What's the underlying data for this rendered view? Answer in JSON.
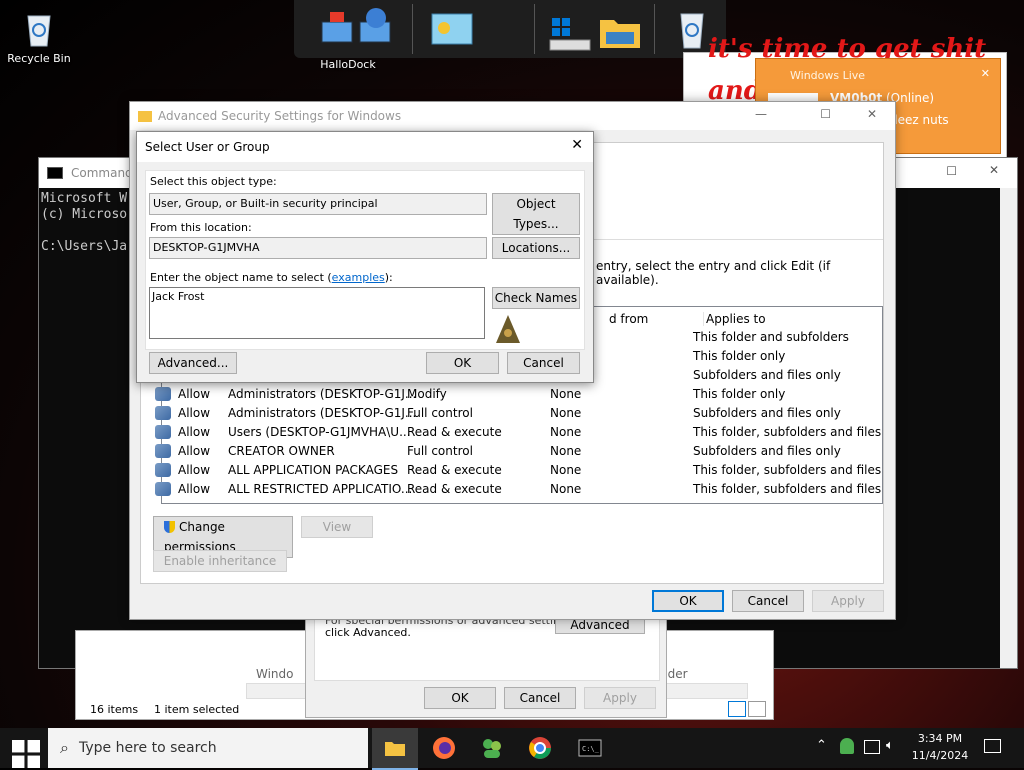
{
  "desktop": {
    "recycle_bin": "Recycle Bin",
    "dock_label": "HalloDock",
    "graffiti_line1": "it's time to get shit",
    "graffiti_line2": "and",
    "popup_title": "Windows Live",
    "popup_user": "VM0b0t",
    "popup_status": "(Online)",
    "popup_msg": "deez nuts"
  },
  "console": {
    "title": "Command",
    "lines": [
      "Microsoft W",
      "(c) Microso",
      "",
      "C:\\Users\\Ja"
    ]
  },
  "adv_dialog": {
    "title": "Advanced Security Settings for Windows",
    "instructions": "entry, select the entry and click Edit (if available).",
    "col_inherited": "d from",
    "col_applies": "Applies to",
    "rows": [
      {
        "type": "",
        "principal": "",
        "access": "",
        "inherited": "",
        "applies": "This folder and subfolders"
      },
      {
        "type": "",
        "principal": "",
        "access": "",
        "inherited": "",
        "applies": "This folder only"
      },
      {
        "type": "",
        "principal": "",
        "access": "",
        "inherited": "",
        "applies": "Subfolders and files only"
      },
      {
        "type": "Allow",
        "principal": "Administrators (DESKTOP-G1J...",
        "access": "Modify",
        "inherited": "None",
        "applies": "This folder only"
      },
      {
        "type": "Allow",
        "principal": "Administrators (DESKTOP-G1J...",
        "access": "Full control",
        "inherited": "None",
        "applies": "Subfolders and files only"
      },
      {
        "type": "Allow",
        "principal": "Users (DESKTOP-G1JMVHA\\U...",
        "access": "Read & execute",
        "inherited": "None",
        "applies": "This folder, subfolders and files"
      },
      {
        "type": "Allow",
        "principal": "CREATOR OWNER",
        "access": "Full control",
        "inherited": "None",
        "applies": "Subfolders and files only"
      },
      {
        "type": "Allow",
        "principal": "ALL APPLICATION PACKAGES",
        "access": "Read & execute",
        "inherited": "None",
        "applies": "This folder, subfolders and files"
      },
      {
        "type": "Allow",
        "principal": "ALL RESTRICTED APPLICATIO...",
        "access": "Read & execute",
        "inherited": "None",
        "applies": "This folder, subfolders and files"
      }
    ],
    "change_permissions": "Change permissions",
    "view": "View",
    "enable_inheritance": "Enable inheritance",
    "ok": "OK",
    "cancel": "Cancel",
    "apply": "Apply"
  },
  "props_dialog": {
    "text1": "For special permissions or advanced settings,",
    "text2": "click Advanced.",
    "advanced": "Advanced",
    "ok": "OK",
    "cancel": "Cancel",
    "apply": "Apply"
  },
  "explorer": {
    "items": "16 items",
    "selected": "1 item selected",
    "crumb": "Windo",
    "crumb2": "nder"
  },
  "select_dialog": {
    "title": "Select User or Group",
    "object_type_label": "Select this object type:",
    "object_type_value": "User, Group, or Built-in security principal",
    "object_types_btn": "Object Types...",
    "location_label": "From this location:",
    "location_value": "DESKTOP-G1JMVHA",
    "locations_btn": "Locations...",
    "name_label_pre": "Enter the object name to select (",
    "name_label_link": "examples",
    "name_label_post": "):",
    "name_value": "Jack Frost",
    "check_names_btn": "Check Names",
    "advanced_btn": "Advanced...",
    "ok_btn": "OK",
    "cancel_btn": "Cancel"
  },
  "taskbar": {
    "search_placeholder": "Type here to search",
    "time": "3:34 PM",
    "date": "11/4/2024"
  }
}
